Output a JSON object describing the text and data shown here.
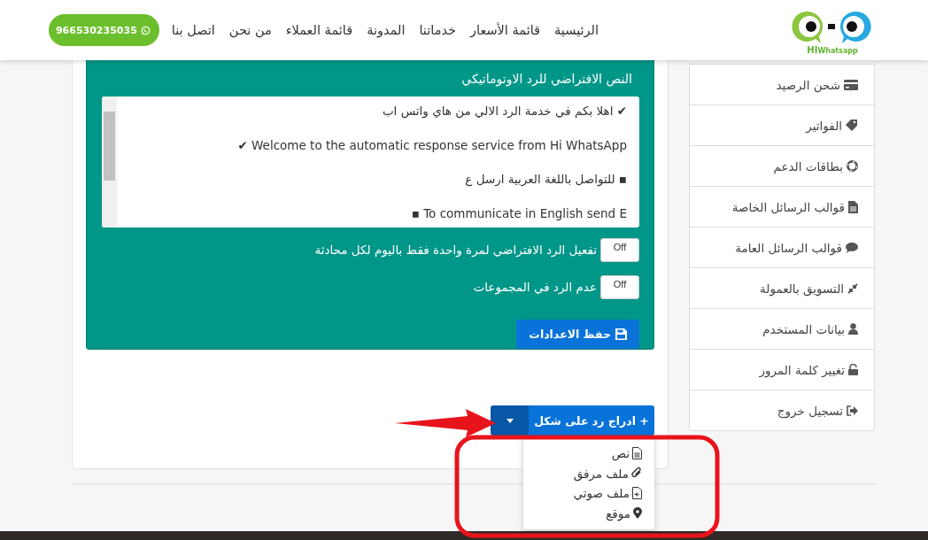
{
  "header": {
    "logo": {
      "title": "HI",
      "subtitle": "Whatsapp"
    },
    "nav": [
      {
        "label": "الرئيسية"
      },
      {
        "label": "قائمة الأسعار"
      },
      {
        "label": "خدماتنا"
      },
      {
        "label": "المدونة"
      },
      {
        "label": "قائمة العملاء"
      },
      {
        "label": "من نحن"
      },
      {
        "label": "اتصل بنا"
      }
    ],
    "contact_button": "966530235035"
  },
  "sidebar": {
    "items": [
      {
        "label": "شحن الرصيد"
      },
      {
        "label": "الفواتير"
      },
      {
        "label": "بطاقات الدعم"
      },
      {
        "label": "قوالب الرسائل الخاصة"
      },
      {
        "label": "قوالب الرسائل العامة"
      },
      {
        "label": "التسويق بالعمولة"
      },
      {
        "label": "بيانات المستخدم"
      },
      {
        "label": "تغيير كلمة المرور"
      },
      {
        "label": "تسجيل خروج"
      }
    ]
  },
  "panel": {
    "title": "النص الافتراضي للرد الاوتوماتيكي",
    "message_lines": [
      "✔ اهلا بكم في خدمة الرد الالي من هاي واتس اب",
      "Welcome to the automatic response service from Hi WhatsApp ✔",
      "▪ للتواصل باللغة العربية ارسل ع",
      "To communicate in English send E ▪"
    ],
    "toggles": [
      {
        "label": "تفعيل الرد الافتراضي لمرة واحدة فقط باليوم لكل محادثة",
        "state_text": "Off",
        "on": false
      },
      {
        "label": "عدم الرد في المجموعات",
        "state_text": "Off",
        "on": false
      }
    ],
    "save_button": "حفظ الاعدادات"
  },
  "insert_button": {
    "label": "+ ادراج رد على شكل",
    "expanded": true
  },
  "insert_menu": [
    {
      "label": "نص"
    },
    {
      "label": "ملف مرفق"
    },
    {
      "label": "ملف صوتي"
    },
    {
      "label": "موقع"
    }
  ]
}
